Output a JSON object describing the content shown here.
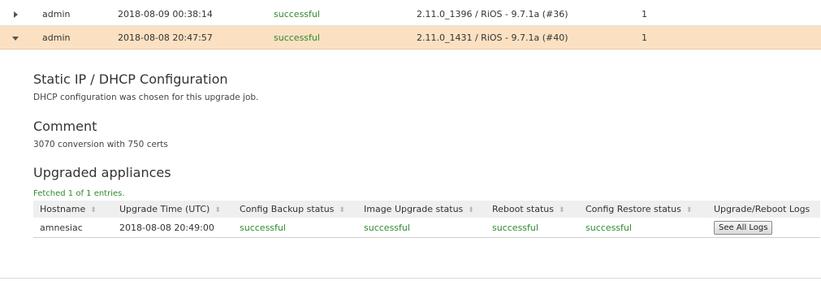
{
  "jobs": [
    {
      "user": "admin",
      "time": "2018-08-09 00:38:14",
      "status": "successful",
      "version": "2.11.0_1396 / RiOS - 9.7.1a (#36)",
      "count": "1",
      "expanded": false
    },
    {
      "user": "admin",
      "time": "2018-08-08 20:47:57",
      "status": "successful",
      "version": "2.11.0_1431 / RiOS - 9.7.1a (#40)",
      "count": "1",
      "expanded": true
    }
  ],
  "detail": {
    "static_title": "Static IP / DHCP Configuration",
    "static_text": "DHCP configuration was chosen for this upgrade job.",
    "comment_title": "Comment",
    "comment_text": "3070 conversion with 750 certs",
    "upgraded_title": "Upgraded appliances",
    "fetched": "Fetched 1 of 1 entries."
  },
  "table": {
    "headers": [
      "Hostname",
      "Upgrade Time (UTC)",
      "Config Backup status",
      "Image Upgrade status",
      "Reboot status",
      "Config Restore status",
      "Upgrade/Reboot Logs"
    ],
    "row": {
      "hostname": "amnesiac",
      "time": "2018-08-08 20:49:00",
      "backup": "successful",
      "image": "successful",
      "reboot": "successful",
      "restore": "successful",
      "logs_button": "See All Logs"
    }
  },
  "colors": {
    "success": "#2d8a2d",
    "expanded_row": "#fbe1c2"
  },
  "icons": {
    "collapsed": "caret-right-icon",
    "expanded": "caret-down-icon",
    "sort": "sort-icon"
  }
}
